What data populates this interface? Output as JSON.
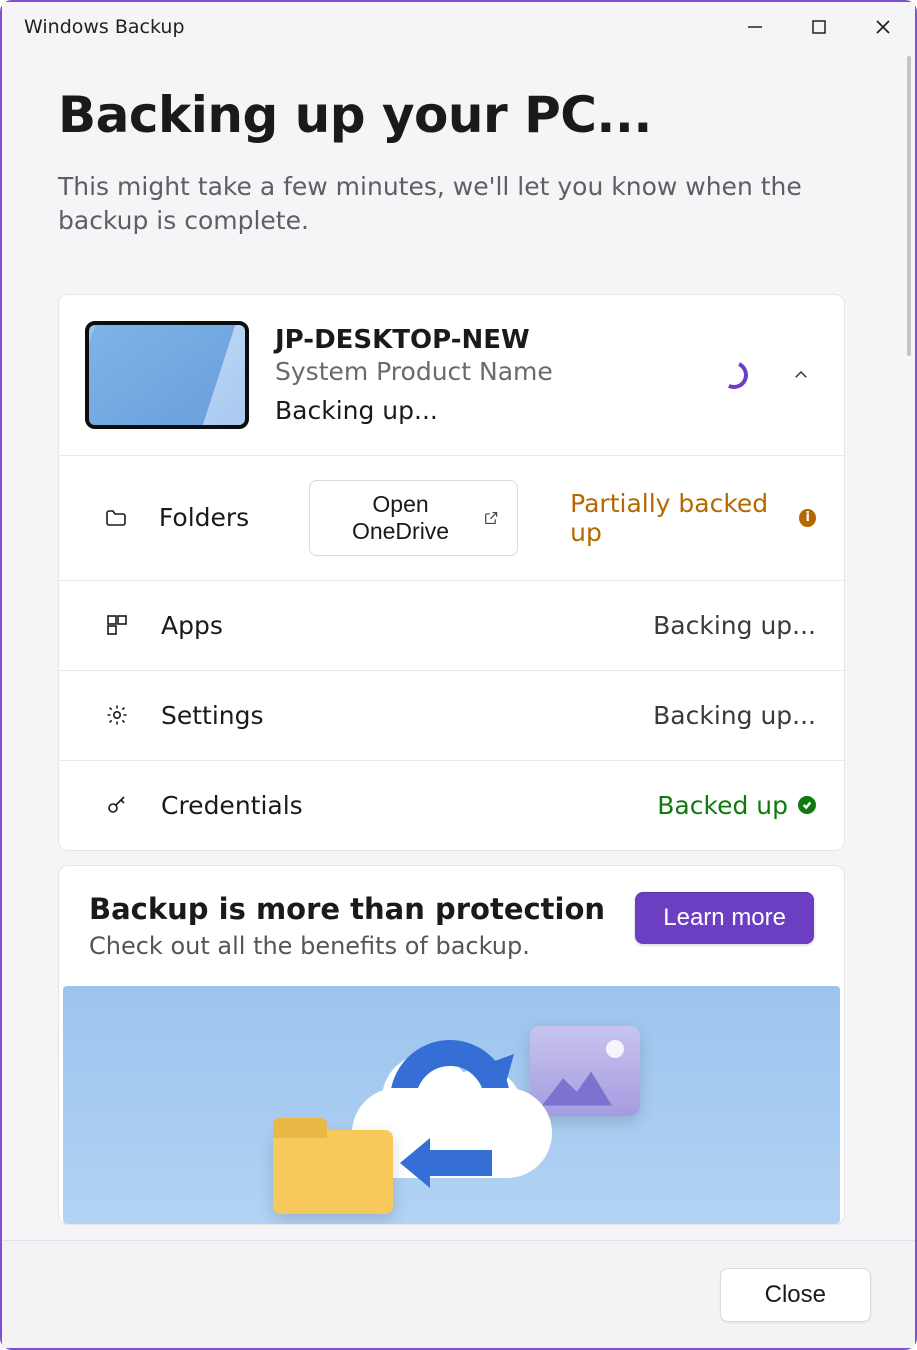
{
  "window": {
    "title": "Windows Backup"
  },
  "page": {
    "heading": "Backing up your PC...",
    "subtitle": "This might take a few minutes, we'll let you know when the backup is complete."
  },
  "device": {
    "name": "JP-DESKTOP-NEW",
    "model": "System Product Name",
    "status": "Backing up..."
  },
  "categories": {
    "folders": {
      "label": "Folders",
      "action": "Open OneDrive",
      "status": "Partially backed up",
      "status_kind": "warn"
    },
    "apps": {
      "label": "Apps",
      "status": "Backing up...",
      "status_kind": "progress"
    },
    "settings": {
      "label": "Settings",
      "status": "Backing up...",
      "status_kind": "progress"
    },
    "credentials": {
      "label": "Credentials",
      "status": "Backed up",
      "status_kind": "ok"
    }
  },
  "promo": {
    "title": "Backup is more than protection",
    "subtitle": "Check out all the benefits of backup.",
    "cta": "Learn more"
  },
  "footer": {
    "close": "Close"
  },
  "colors": {
    "accent": "#6c3fc2",
    "warn": "#b46900",
    "ok": "#0f7b0f"
  }
}
